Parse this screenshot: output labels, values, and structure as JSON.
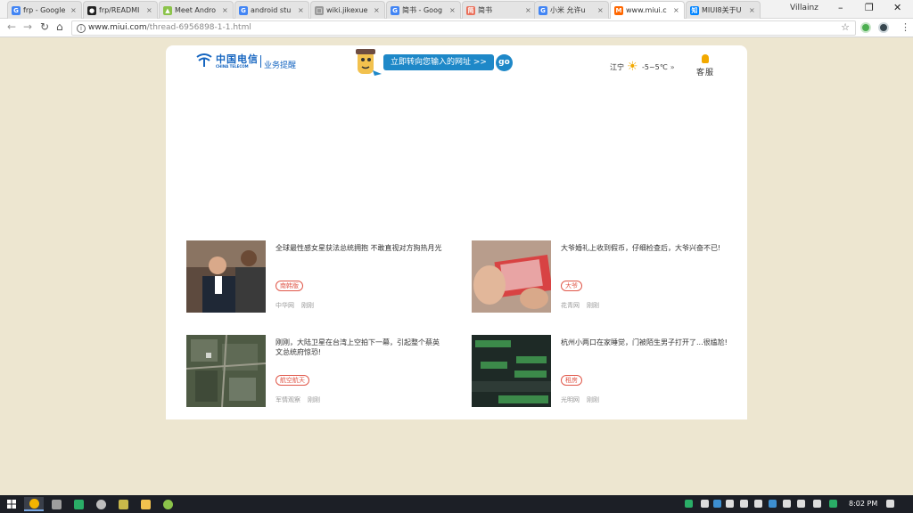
{
  "browser": {
    "tabs": [
      {
        "label": "frp - Google",
        "icon": "google-icon",
        "active": false
      },
      {
        "label": "frp/READMI",
        "icon": "github-icon",
        "active": false
      },
      {
        "label": "Meet Andro",
        "icon": "android-icon",
        "active": false
      },
      {
        "label": "android stu",
        "icon": "google-icon",
        "active": false
      },
      {
        "label": "wiki.jikexue",
        "icon": "page-icon",
        "active": false
      },
      {
        "label": "简书 - Goog",
        "icon": "google-icon",
        "active": false
      },
      {
        "label": "简书",
        "icon": "jianshu-icon",
        "active": false
      },
      {
        "label": "小米 允许u",
        "icon": "google-icon",
        "active": false
      },
      {
        "label": "www.miui.c",
        "icon": "miui-icon",
        "active": true
      },
      {
        "label": "MIUI8关于U",
        "icon": "zhihu-icon",
        "active": false
      }
    ],
    "profile_name": "Villainz",
    "url_host": "www.miui.com",
    "url_path": "/thread-6956898-1-1.html"
  },
  "header": {
    "logo_cn": "中国电信",
    "logo_en": "CHINA TELECOM",
    "service_label": "业务提醒",
    "redirect_text": "立即转向您输入的网址 >>",
    "go_label": "go",
    "weather_city": "江宁",
    "weather_temp": "-5~5℃",
    "weather_more": "»",
    "customer_service": "客服"
  },
  "news": [
    {
      "title": "全球最性感女星获法总统拥抱 不敢直视对方狗热月光",
      "tag": "南韩版",
      "source": "中华网",
      "time": "刚刚"
    },
    {
      "title": "大爷婚礼上收到假币，仔细检查后，大爷兴奋不已!",
      "tag": "大爷",
      "source": "花青网",
      "time": "刚刚"
    },
    {
      "title": "刚刚，大陆卫星在台湾上空拍下一幕，引起整个蔡英文总统府惊恐!",
      "tag": "航空航天",
      "source": "军情观察",
      "time": "刚刚"
    },
    {
      "title": "杭州小两口在家睡觉，门被陌生男子打开了...很尴尬!",
      "tag": "租房",
      "source": "光明网",
      "time": "刚刚"
    }
  ],
  "taskbar": {
    "clock": "8:02 PM"
  }
}
